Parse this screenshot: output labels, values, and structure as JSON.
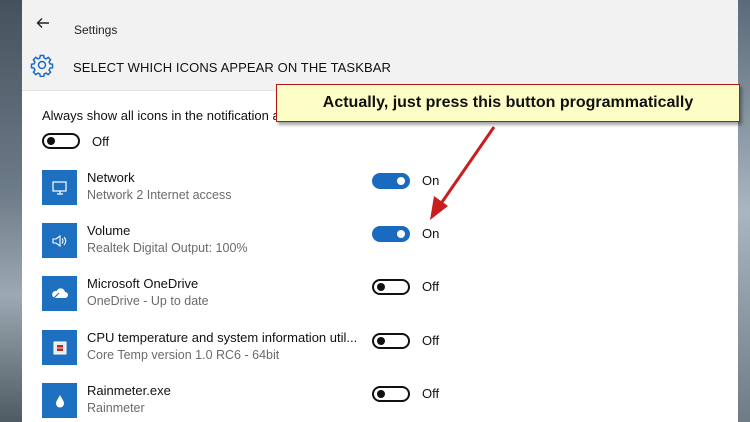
{
  "window": {
    "title": "Settings"
  },
  "header": {
    "title": "SELECT WHICH ICONS APPEAR ON THE TASKBAR"
  },
  "always_show": {
    "label": "Always show all icons in the notification area",
    "state": "Off"
  },
  "items": [
    {
      "name": "Network",
      "detail": "Network  2 Internet access",
      "state": "On",
      "icon": "network-icon"
    },
    {
      "name": "Volume",
      "detail": "Realtek Digital Output: 100%",
      "state": "On",
      "icon": "volume-icon"
    },
    {
      "name": "Microsoft OneDrive",
      "detail": "OneDrive - Up to date",
      "state": "Off",
      "icon": "onedrive-icon"
    },
    {
      "name": "CPU temperature and system information util...",
      "detail": "Core Temp version 1.0 RC6 - 64bit",
      "state": "Off",
      "icon": "core-temp-icon"
    },
    {
      "name": "Rainmeter.exe",
      "detail": "Rainmeter",
      "state": "Off",
      "icon": "rainmeter-icon"
    }
  ],
  "callout": {
    "text": "Actually, just press this button programmatically"
  },
  "colors": {
    "accent": "#1a6ac0",
    "callout_bg": "#fdfdc6",
    "arrow": "#c81e1e"
  }
}
